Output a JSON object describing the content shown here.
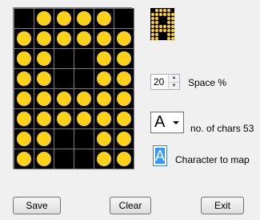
{
  "grid": {
    "rows": 8,
    "cols": 6,
    "pattern": [
      [
        0,
        1,
        1,
        1,
        1,
        0
      ],
      [
        1,
        1,
        1,
        1,
        1,
        1
      ],
      [
        1,
        1,
        0,
        0,
        1,
        1
      ],
      [
        1,
        1,
        0,
        0,
        1,
        1
      ],
      [
        1,
        1,
        1,
        1,
        1,
        1
      ],
      [
        1,
        1,
        1,
        1,
        1,
        1
      ],
      [
        1,
        1,
        0,
        0,
        1,
        1
      ],
      [
        1,
        1,
        0,
        0,
        1,
        1
      ]
    ],
    "on_color": "#ffd21a",
    "off_color": "#000000"
  },
  "space": {
    "value": "20",
    "label": "Space %"
  },
  "charset": {
    "selected": "A",
    "count_label": "no. of chars 53"
  },
  "character": {
    "value": "A",
    "label": "Character to map"
  },
  "buttons": {
    "save": "Save",
    "clear": "Clear",
    "exit": "Exit"
  }
}
